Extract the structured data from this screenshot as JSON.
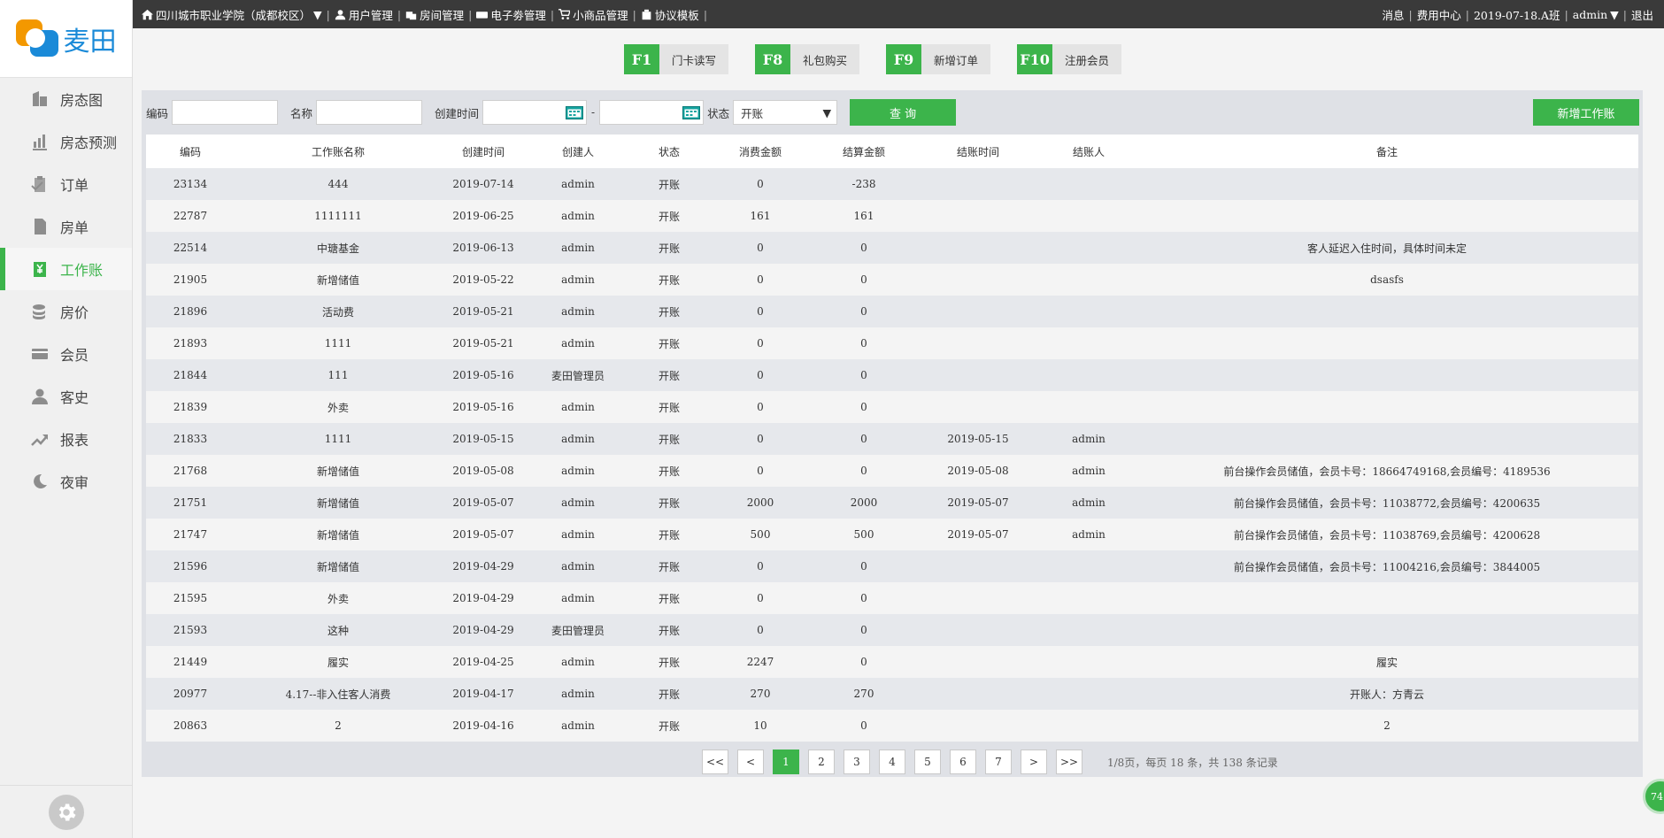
{
  "brand": {
    "name": "麦田"
  },
  "topbar": {
    "hotel": "四川城市职业学院（成都校区）",
    "nav": [
      "用户管理",
      "房间管理",
      "电子劵管理",
      "小商品管理",
      "协议模板"
    ],
    "messages": "消息",
    "fee_center": "费用中心",
    "shift": "2019-07-18.A班",
    "user": "admin",
    "logout": "退出"
  },
  "sidebar": {
    "items": [
      {
        "label": "房态图",
        "icon": "building-icon"
      },
      {
        "label": "房态预测",
        "icon": "bar-chart-icon"
      },
      {
        "label": "订单",
        "icon": "clipboard-icon"
      },
      {
        "label": "房单",
        "icon": "document-icon"
      },
      {
        "label": "工作账",
        "icon": "ledger-yen-icon",
        "active": true
      },
      {
        "label": "房价",
        "icon": "coins-icon"
      },
      {
        "label": "会员",
        "icon": "card-icon"
      },
      {
        "label": "客史",
        "icon": "user-icon"
      },
      {
        "label": "报表",
        "icon": "trend-icon"
      },
      {
        "label": "夜审",
        "icon": "moon-icon"
      }
    ]
  },
  "hotkeys": [
    {
      "key": "F1",
      "label": "门卡读写"
    },
    {
      "key": "F8",
      "label": "礼包购买"
    },
    {
      "key": "F9",
      "label": "新增订单"
    },
    {
      "key": "F10",
      "label": "注册会员"
    }
  ],
  "filters": {
    "code_label": "编码",
    "name_label": "名称",
    "created_label": "创建时间",
    "date_separator": "-",
    "status_label": "状态",
    "status_value": "开账",
    "query_button": "查  询",
    "new_button": "新增工作账"
  },
  "table": {
    "headers": [
      "编码",
      "工作账名称",
      "创建时间",
      "创建人",
      "状态",
      "消费金额",
      "结算金额",
      "结账时间",
      "结账人",
      "备注"
    ],
    "rows": [
      [
        "23134",
        "444",
        "2019-07-14",
        "admin",
        "开账",
        "0",
        "-238",
        "",
        "",
        ""
      ],
      [
        "22787",
        "1111111",
        "2019-06-25",
        "admin",
        "开账",
        "161",
        "161",
        "",
        "",
        ""
      ],
      [
        "22514",
        "中瑭基金",
        "2019-06-13",
        "admin",
        "开账",
        "0",
        "0",
        "",
        "",
        "客人延迟入住时间，具体时间未定"
      ],
      [
        "21905",
        "新增储值",
        "2019-05-22",
        "admin",
        "开账",
        "0",
        "0",
        "",
        "",
        "dsasfs"
      ],
      [
        "21896",
        "活动费",
        "2019-05-21",
        "admin",
        "开账",
        "0",
        "0",
        "",
        "",
        ""
      ],
      [
        "21893",
        "1111",
        "2019-05-21",
        "admin",
        "开账",
        "0",
        "0",
        "",
        "",
        ""
      ],
      [
        "21844",
        "111",
        "2019-05-16",
        "麦田管理员",
        "开账",
        "0",
        "0",
        "",
        "",
        ""
      ],
      [
        "21839",
        "外卖",
        "2019-05-16",
        "admin",
        "开账",
        "0",
        "0",
        "",
        "",
        ""
      ],
      [
        "21833",
        "1111",
        "2019-05-15",
        "admin",
        "开账",
        "0",
        "0",
        "2019-05-15",
        "admin",
        ""
      ],
      [
        "21768",
        "新增储值",
        "2019-05-08",
        "admin",
        "开账",
        "0",
        "0",
        "2019-05-08",
        "admin",
        "前台操作会员储值，会员卡号：18664749168,会员编号：4189536"
      ],
      [
        "21751",
        "新增储值",
        "2019-05-07",
        "admin",
        "开账",
        "2000",
        "2000",
        "2019-05-07",
        "admin",
        "前台操作会员储值，会员卡号：11038772,会员编号：4200635"
      ],
      [
        "21747",
        "新增储值",
        "2019-05-07",
        "admin",
        "开账",
        "500",
        "500",
        "2019-05-07",
        "admin",
        "前台操作会员储值，会员卡号：11038769,会员编号：4200628"
      ],
      [
        "21596",
        "新增储值",
        "2019-04-29",
        "admin",
        "开账",
        "0",
        "0",
        "",
        "",
        "前台操作会员储值，会员卡号：11004216,会员编号：3844005"
      ],
      [
        "21595",
        "外卖",
        "2019-04-29",
        "admin",
        "开账",
        "0",
        "0",
        "",
        "",
        ""
      ],
      [
        "21593",
        "这种",
        "2019-04-29",
        "麦田管理员",
        "开账",
        "0",
        "0",
        "",
        "",
        ""
      ],
      [
        "21449",
        "履实",
        "2019-04-25",
        "admin",
        "开账",
        "2247",
        "0",
        "",
        "",
        "履实"
      ],
      [
        "20977",
        "4.17--非入住客人消费",
        "2019-04-17",
        "admin",
        "开账",
        "270",
        "270",
        "",
        "",
        "开账人：方青云"
      ],
      [
        "20863",
        "2",
        "2019-04-16",
        "admin",
        "开账",
        "10",
        "0",
        "",
        "",
        "2"
      ]
    ]
  },
  "pagination": {
    "buttons": [
      "<<",
      "<",
      "1",
      "2",
      "3",
      "4",
      "5",
      "6",
      "7",
      ">",
      ">>"
    ],
    "current": "1",
    "info": "1/8页，每页 18 条，共 138 条记录"
  },
  "float_badge": "74"
}
